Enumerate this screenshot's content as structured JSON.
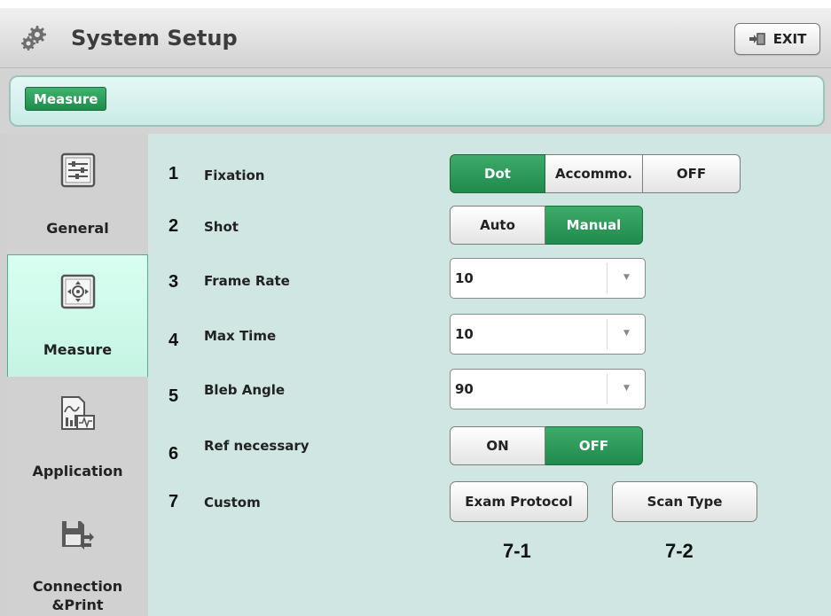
{
  "header": {
    "title": "System Setup",
    "exit_label": "EXIT"
  },
  "breadcrumb": {
    "current": "Measure"
  },
  "sidebar": {
    "items": [
      {
        "label": "General",
        "icon": "sliders-icon",
        "active": false
      },
      {
        "label": "Measure",
        "icon": "target-icon",
        "active": true
      },
      {
        "label": "Application",
        "icon": "chart-icon",
        "active": false
      },
      {
        "label_line1": "Connection",
        "label_line2": "&Print",
        "icon": "save-transfer-icon",
        "active": false
      }
    ]
  },
  "settings": {
    "fixation": {
      "num": "1",
      "label": "Fixation",
      "options": [
        "Dot",
        "Accommo.",
        "OFF"
      ],
      "selected": "Dot"
    },
    "shot": {
      "num": "2",
      "label": "Shot",
      "options": [
        "Auto",
        "Manual"
      ],
      "selected": "Manual"
    },
    "frame_rate": {
      "num": "3",
      "label": "Frame Rate",
      "value": "10"
    },
    "max_time": {
      "num": "4",
      "label": "Max Time",
      "value": "10"
    },
    "bleb_angle": {
      "num": "5",
      "label": "Bleb Angle",
      "value": "90"
    },
    "ref_necessary": {
      "num": "6",
      "label": "Ref necessary",
      "options": [
        "ON",
        "OFF"
      ],
      "selected": "OFF"
    },
    "custom": {
      "num": "7",
      "label": "Custom",
      "exam_protocol_label": "Exam Protocol",
      "scan_type_label": "Scan Type",
      "exam_protocol_sub": "7-1",
      "scan_type_sub": "7-2"
    }
  },
  "colors": {
    "accent_green": "#1f8a4c",
    "panel_bg": "#cfe6e3",
    "active_sidebar_bg": "#c5f4e3"
  }
}
